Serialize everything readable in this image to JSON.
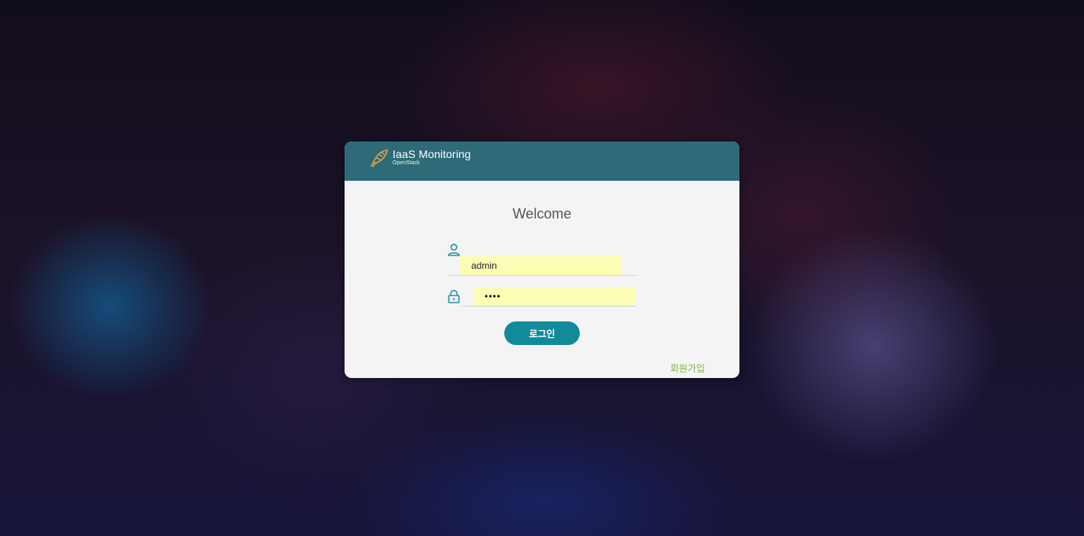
{
  "header": {
    "app_title": "IaaS Monitoring",
    "app_subtitle": "OpenStack",
    "logo_icon": "rocket-feather-icon"
  },
  "form": {
    "welcome": "Welcome",
    "username_icon": "user-icon",
    "username_value": "admin",
    "password_icon": "lock-icon",
    "password_value": "••••",
    "login_label": "로그인",
    "signup_label": "회원가입"
  },
  "colors": {
    "header_bg": "#2d6b78",
    "accent": "#138a9a",
    "input_autofill_bg": "#fbfdb5",
    "signup_link": "#7cb342",
    "icon": "#2b8fa5"
  }
}
